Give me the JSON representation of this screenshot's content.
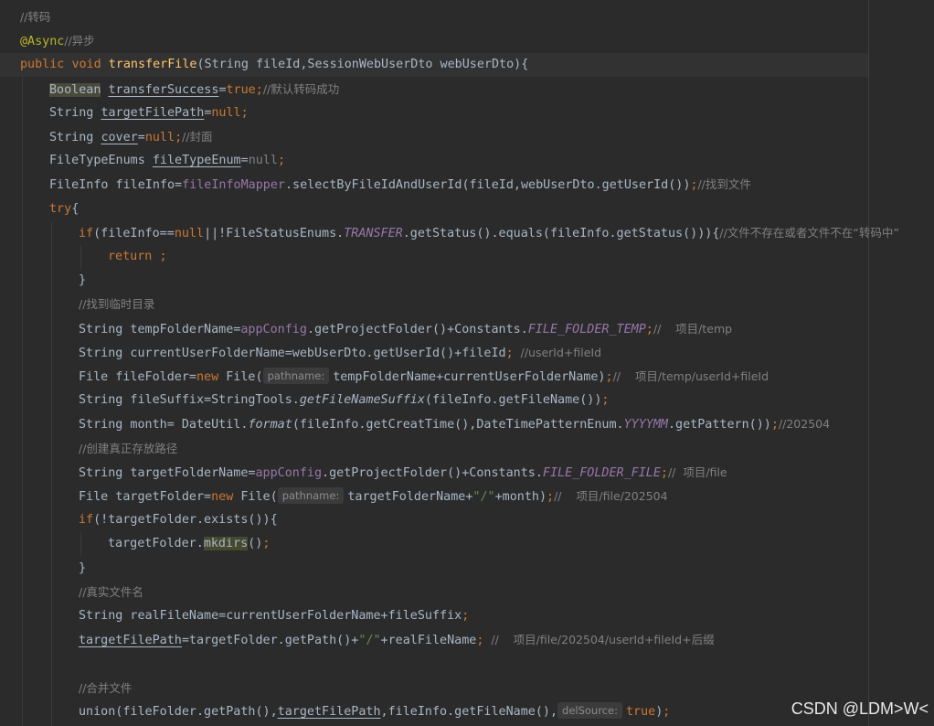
{
  "editor": {
    "lines": [
      [
        {
          "t": "//转码",
          "c": "cmt"
        }
      ],
      [
        {
          "t": "@Async",
          "c": "ann"
        },
        {
          "t": "//异步",
          "c": "cmt"
        }
      ],
      [
        {
          "t": "public ",
          "c": "kw"
        },
        {
          "t": "void ",
          "c": "kw"
        },
        {
          "t": "transferFile",
          "c": "fn"
        },
        {
          "t": "(String fileId,SessionWebUserDto webUserDto){",
          "c": ""
        }
      ],
      [
        {
          "t": "Boolean",
          "c": "hl"
        },
        {
          "t": " ",
          "c": ""
        },
        {
          "t": "transferSuccess",
          "c": "ul"
        },
        {
          "t": "=",
          "c": ""
        },
        {
          "t": "true",
          "c": "kw"
        },
        {
          "t": ";",
          "c": "kw"
        },
        {
          "t": "//默认转码成功",
          "c": "cmt"
        }
      ],
      [
        {
          "t": "String ",
          "c": ""
        },
        {
          "t": "targetFilePath",
          "c": "ul"
        },
        {
          "t": "=",
          "c": ""
        },
        {
          "t": "null",
          "c": "kw"
        },
        {
          "t": ";",
          "c": "kw"
        }
      ],
      [
        {
          "t": "String ",
          "c": ""
        },
        {
          "t": "cover",
          "c": "ul"
        },
        {
          "t": "=",
          "c": ""
        },
        {
          "t": "null",
          "c": "kw"
        },
        {
          "t": ";",
          "c": "kw"
        },
        {
          "t": "//封面",
          "c": "cmt"
        }
      ],
      [
        {
          "t": "FileTypeEnums ",
          "c": ""
        },
        {
          "t": "fileTypeEnum",
          "c": "ul"
        },
        {
          "t": "=",
          "c": ""
        },
        {
          "t": "null",
          "c": "gray"
        },
        {
          "t": ";",
          "c": "kw"
        }
      ],
      [
        {
          "t": "FileInfo fileInfo=",
          "c": ""
        },
        {
          "t": "fileInfoMapper",
          "c": "fld"
        },
        {
          "t": ".selectByFileIdAndUserId(fileId,webUserDto.getUserId())",
          "c": ""
        },
        {
          "t": ";",
          "c": "kw"
        },
        {
          "t": "//找到文件",
          "c": "cmt"
        }
      ],
      [
        {
          "t": "try",
          "c": "kw"
        },
        {
          "t": "{",
          "c": ""
        }
      ],
      [
        {
          "t": "if",
          "c": "kw"
        },
        {
          "t": "(fileInfo==",
          "c": ""
        },
        {
          "t": "null",
          "c": "kw"
        },
        {
          "t": "||!FileStatusEnums.",
          "c": ""
        },
        {
          "t": "TRANSFER",
          "c": "stf"
        },
        {
          "t": ".getStatus().equals(fileInfo.getStatus())){",
          "c": ""
        },
        {
          "t": "//文件不存在或者文件不在“转码中”",
          "c": "cmt"
        }
      ],
      [
        {
          "t": "return ",
          "c": "kw"
        },
        {
          "t": ";",
          "c": "kw"
        }
      ],
      [
        {
          "t": "}",
          "c": ""
        }
      ],
      [
        {
          "t": "//找到临时目录",
          "c": "cmt"
        }
      ],
      [
        {
          "t": "String tempFolderName=",
          "c": ""
        },
        {
          "t": "appConfig",
          "c": "fld"
        },
        {
          "t": ".getProjectFolder()+Constants.",
          "c": ""
        },
        {
          "t": "FILE_FOLDER_TEMP",
          "c": "stf"
        },
        {
          "t": ";",
          "c": "kw"
        },
        {
          "t": "//    项目/temp",
          "c": "cmt"
        }
      ],
      [
        {
          "t": "String currentUserFolderName=webUserDto.getUserId()+fileId",
          "c": ""
        },
        {
          "t": ";",
          "c": "kw"
        },
        {
          "t": "  //userId+fileId",
          "c": "cmt"
        }
      ],
      [
        {
          "t": "File fileFolder=",
          "c": ""
        },
        {
          "t": "new ",
          "c": "kw"
        },
        {
          "t": "File(",
          "c": ""
        },
        {
          "t": "pathname:",
          "c": "hint"
        },
        {
          "t": "tempFolderName+currentUserFolderName)",
          "c": ""
        },
        {
          "t": ";",
          "c": "kw"
        },
        {
          "t": "//    项目/temp/userId+fileId",
          "c": "cmt"
        }
      ],
      [
        {
          "t": "String fileSuffix=StringTools.",
          "c": ""
        },
        {
          "t": "getFileNameSuffix",
          "c": "ital"
        },
        {
          "t": "(fileInfo.getFileName())",
          "c": ""
        },
        {
          "t": ";",
          "c": "kw"
        }
      ],
      [
        {
          "t": "String month= DateUtil.",
          "c": ""
        },
        {
          "t": "format",
          "c": "ital"
        },
        {
          "t": "(fileInfo.getCreatTime(),DateTimePatternEnum.",
          "c": ""
        },
        {
          "t": "YYYYMM",
          "c": "stf"
        },
        {
          "t": ".getPattern())",
          "c": ""
        },
        {
          "t": ";",
          "c": "kw"
        },
        {
          "t": "//202504",
          "c": "cmt"
        }
      ],
      [
        {
          "t": "//创建真正存放路径",
          "c": "cmt"
        }
      ],
      [
        {
          "t": "String targetFolderName=",
          "c": ""
        },
        {
          "t": "appConfig",
          "c": "fld"
        },
        {
          "t": ".getProjectFolder()+Constants.",
          "c": ""
        },
        {
          "t": "FILE_FOLDER_FILE",
          "c": "stf"
        },
        {
          "t": ";",
          "c": "kw"
        },
        {
          "t": "//  项目/file",
          "c": "cmt"
        }
      ],
      [
        {
          "t": "File targetFolder=",
          "c": ""
        },
        {
          "t": "new ",
          "c": "kw"
        },
        {
          "t": "File(",
          "c": ""
        },
        {
          "t": "pathname:",
          "c": "hint"
        },
        {
          "t": "targetFolderName+",
          "c": ""
        },
        {
          "t": "\"/\"",
          "c": "str"
        },
        {
          "t": "+month)",
          "c": ""
        },
        {
          "t": ";",
          "c": "kw"
        },
        {
          "t": "//    项目/file/202504",
          "c": "cmt"
        }
      ],
      [
        {
          "t": "if",
          "c": "kw"
        },
        {
          "t": "(!targetFolder.exists()){",
          "c": ""
        }
      ],
      [
        {
          "t": "targetFolder.",
          "c": ""
        },
        {
          "t": "mkdirs",
          "c": "hl2"
        },
        {
          "t": "()",
          "c": ""
        },
        {
          "t": ";",
          "c": "kw"
        }
      ],
      [
        {
          "t": "}",
          "c": ""
        }
      ],
      [
        {
          "t": "//真实文件名",
          "c": "cmt"
        }
      ],
      [
        {
          "t": "String realFileName=currentUserFolderName+fileSuffix",
          "c": ""
        },
        {
          "t": ";",
          "c": "kw"
        }
      ],
      [
        {
          "t": "targetFilePath",
          "c": "ul"
        },
        {
          "t": "=targetFolder.getPath()+",
          "c": ""
        },
        {
          "t": "\"/\"",
          "c": "str"
        },
        {
          "t": "+realFileName",
          "c": ""
        },
        {
          "t": ";",
          "c": "kw"
        },
        {
          "t": "  //    项目/file/202504/userId+fileId+后缀",
          "c": "cmt"
        }
      ],
      [],
      [
        {
          "t": "//合并文件",
          "c": "cmt"
        }
      ],
      [
        {
          "t": "union(fileFolder.getPath(),",
          "c": ""
        },
        {
          "t": "targetFilePath",
          "c": "ul"
        },
        {
          "t": ",fileInfo.getFileName(),",
          "c": ""
        },
        {
          "t": "delSource:",
          "c": "hint"
        },
        {
          "t": "true",
          "c": "kw"
        },
        {
          "t": ")",
          "c": ""
        },
        {
          "t": ";",
          "c": "kw"
        }
      ]
    ]
  },
  "watermark": "CSDN @LDM>W<"
}
